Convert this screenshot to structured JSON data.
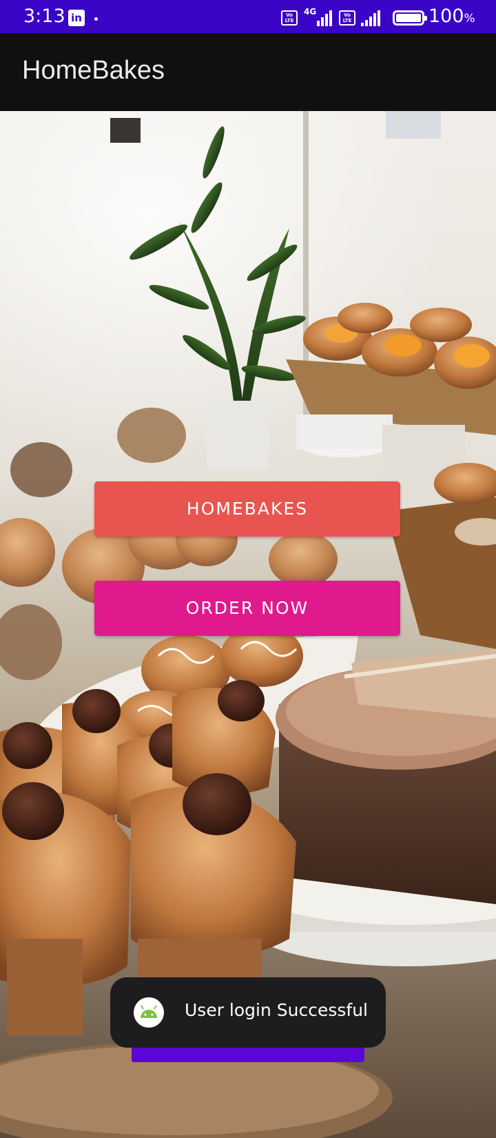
{
  "status_bar": {
    "time": "3:13",
    "app_icon": "linkedin-icon",
    "network_type": "4G",
    "volte_label": "Vo LTE",
    "battery_percent": "100",
    "battery_unit": "%"
  },
  "app_bar": {
    "title": "HomeBakes"
  },
  "main": {
    "homebakes_button_label": "HOMEBAKES",
    "order_button_label": "ORDER NOW"
  },
  "toast": {
    "icon": "android-icon",
    "message": "User login Successful"
  },
  "colors": {
    "status_bar": "#3a05c6",
    "app_bar": "#101011",
    "homebakes_button": "#e8544f",
    "order_button": "#e0198c",
    "toast_background": "#1d1d20",
    "toast_accent": "#5a07d6"
  }
}
